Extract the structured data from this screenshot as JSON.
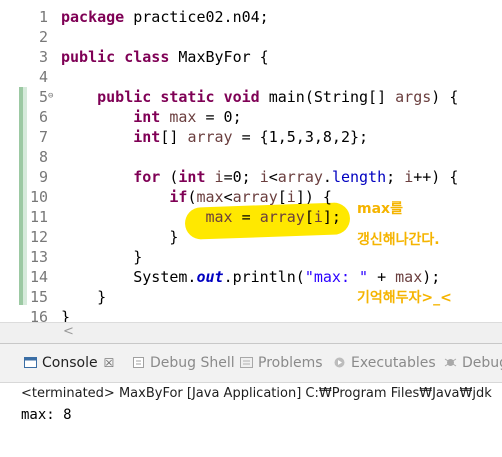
{
  "editor": {
    "lines": [
      {
        "num": "1",
        "tokens": [
          [
            "kw",
            "package"
          ],
          [
            "plain",
            " practice02.n04;"
          ]
        ]
      },
      {
        "num": "2",
        "tokens": []
      },
      {
        "num": "3",
        "tokens": [
          [
            "kw",
            "public"
          ],
          [
            "plain",
            " "
          ],
          [
            "kw",
            "class"
          ],
          [
            "plain",
            " MaxByFor {"
          ]
        ]
      },
      {
        "num": "4",
        "tokens": []
      },
      {
        "num": "5",
        "fold": "⊖",
        "tokens": [
          [
            "plain",
            "    "
          ],
          [
            "kw",
            "public"
          ],
          [
            "plain",
            " "
          ],
          [
            "kw",
            "static"
          ],
          [
            "plain",
            " "
          ],
          [
            "kw",
            "void"
          ],
          [
            "plain",
            " main(String[] "
          ],
          [
            "var",
            "args"
          ],
          [
            "plain",
            ") {"
          ]
        ]
      },
      {
        "num": "6",
        "tokens": [
          [
            "plain",
            "        "
          ],
          [
            "kw",
            "int"
          ],
          [
            "plain",
            " "
          ],
          [
            "var",
            "max"
          ],
          [
            "plain",
            " = 0;"
          ]
        ]
      },
      {
        "num": "7",
        "tokens": [
          [
            "plain",
            "        "
          ],
          [
            "kw",
            "int"
          ],
          [
            "plain",
            "[] "
          ],
          [
            "var",
            "array"
          ],
          [
            "plain",
            " = {1,5,3,8,2};"
          ]
        ]
      },
      {
        "num": "8",
        "tokens": []
      },
      {
        "num": "9",
        "tokens": [
          [
            "plain",
            "        "
          ],
          [
            "kw",
            "for"
          ],
          [
            "plain",
            " ("
          ],
          [
            "kw",
            "int"
          ],
          [
            "plain",
            " "
          ],
          [
            "var",
            "i"
          ],
          [
            "plain",
            "=0; "
          ],
          [
            "var",
            "i"
          ],
          [
            "plain",
            "<"
          ],
          [
            "var",
            "array"
          ],
          [
            "plain",
            "."
          ],
          [
            "fld",
            "length"
          ],
          [
            "plain",
            "; "
          ],
          [
            "var",
            "i"
          ],
          [
            "plain",
            "++) {"
          ]
        ]
      },
      {
        "num": "10",
        "tokens": [
          [
            "plain",
            "            "
          ],
          [
            "kw",
            "if"
          ],
          [
            "plain",
            "("
          ],
          [
            "var",
            "max"
          ],
          [
            "plain",
            "<"
          ],
          [
            "var",
            "array"
          ],
          [
            "plain",
            "["
          ],
          [
            "var",
            "i"
          ],
          [
            "plain",
            "]) {"
          ]
        ]
      },
      {
        "num": "11",
        "tokens": [
          [
            "plain",
            "                "
          ],
          [
            "var",
            "max"
          ],
          [
            "plain",
            " = "
          ],
          [
            "var",
            "array"
          ],
          [
            "plain",
            "["
          ],
          [
            "var",
            "i"
          ],
          [
            "plain",
            "];"
          ]
        ]
      },
      {
        "num": "12",
        "tokens": [
          [
            "plain",
            "            }"
          ]
        ]
      },
      {
        "num": "13",
        "tokens": [
          [
            "plain",
            "        }"
          ]
        ]
      },
      {
        "num": "14",
        "tokens": [
          [
            "plain",
            "        System."
          ],
          [
            "sfld",
            "out"
          ],
          [
            "plain",
            ".println("
          ],
          [
            "str",
            "\"max: \""
          ],
          [
            "plain",
            " + "
          ],
          [
            "var",
            "max"
          ],
          [
            "plain",
            ");"
          ]
        ]
      },
      {
        "num": "15",
        "tokens": [
          [
            "plain",
            "    }"
          ]
        ]
      },
      {
        "num": "16",
        "tokens": [
          [
            "plain",
            "}"
          ]
        ]
      }
    ],
    "annotations": {
      "note1": "max를",
      "note2": "갱신해나간다.",
      "note3": "기억해두자>_<"
    },
    "colors": {
      "annotation": "#f5b400",
      "highlighter": "#ffe800",
      "gutter_marker": "#9cc9a3"
    }
  },
  "console": {
    "tabs": [
      {
        "label": "Console",
        "close": "☒",
        "icon": "console-icon",
        "active": true
      },
      {
        "label": "Debug Shell",
        "icon": "debug-shell-icon",
        "active": false
      },
      {
        "label": "Problems",
        "icon": "problems-icon",
        "active": false
      },
      {
        "label": "Executables",
        "icon": "executables-icon",
        "active": false
      },
      {
        "label": "Debug",
        "icon": "debug-icon",
        "active": false
      }
    ],
    "status": "<terminated> MaxByFor [Java Application] C:₩Program Files₩Java₩jdk",
    "output": "max: 8"
  }
}
